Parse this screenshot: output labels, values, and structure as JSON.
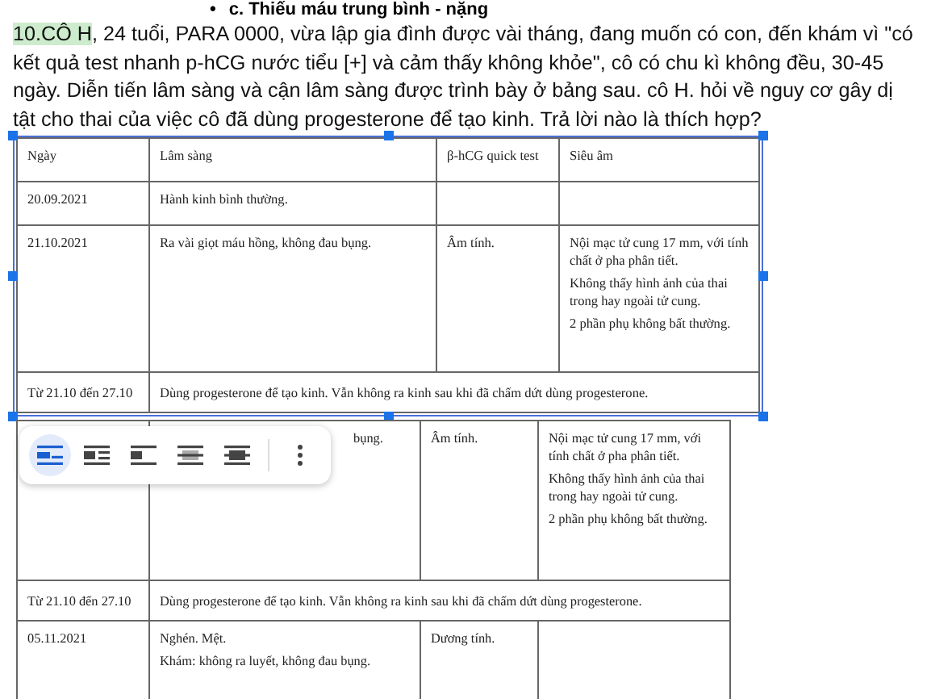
{
  "heading": {
    "bullet": "•",
    "text": "c. Thiếu máu trung bình - nặng"
  },
  "question": {
    "highlight": "10.CÔ H",
    "text": ", 24 tuổi, PARA 0000, vừa lập gia đình được vài tháng, đang muốn có con, đến khám vì \"có kết quả test nhanh p-hCG nước tiểu [+] và cảm thấy không khỏe\", cô có chu kì không đều, 30-45 ngày. Diễn tiến lâm sàng và cận lâm sàng được trình bày ở bảng sau. cô H. hỏi về nguy cơ gây dị tật cho thai của việc cô đã dùng progesterone để tạo kinh. Trả lời nào là thích hợp?"
  },
  "images": [
    {
      "selected": true,
      "rows": [
        {
          "kind": "header",
          "cells": [
            {
              "lines": [
                "Ngày"
              ]
            },
            {
              "lines": [
                "Lâm sàng"
              ]
            },
            {
              "lines": [
                "β-hCG quick test"
              ]
            },
            {
              "lines": [
                "Siêu âm"
              ]
            }
          ]
        },
        {
          "kind": "normal",
          "cells": [
            {
              "lines": [
                "20.09.2021"
              ]
            },
            {
              "lines": [
                "Hành kinh bình thường."
              ]
            },
            {},
            {}
          ]
        },
        {
          "kind": "normal",
          "cells": [
            {
              "lines": [
                "21.10.2021"
              ]
            },
            {
              "lines": [
                "Ra vài giọt máu hồng, không đau bụng."
              ]
            },
            {
              "lines": [
                "Âm tính."
              ]
            },
            {
              "lines": [
                "Nội mạc tử cung 17 mm, với tính chất ở pha phân tiết.",
                "Không thấy hình ảnh của thai trong hay ngoài tử cung.",
                "2 phần phụ không bất thường."
              ]
            }
          ]
        },
        {
          "kind": "span",
          "cells": [
            {
              "lines": [
                "Từ 21.10 đến 27.10"
              ]
            },
            {
              "lines": [
                "Dùng progesterone để tạo kinh. Vẫn không ra kinh sau khi đã chấm dứt dùng progesterone."
              ],
              "colspan": 3
            }
          ]
        }
      ]
    },
    {
      "selected": false,
      "rows": [
        {
          "kind": "normal",
          "cells": [
            {},
            {
              "lines": [
                "bụng."
              ],
              "covered": true
            },
            {
              "lines": [
                "Âm tính."
              ]
            },
            {
              "lines": [
                "Nội mạc tử cung 17 mm, với tính chất ở pha phân tiết.",
                "Không thấy hình ảnh của thai trong hay ngoài tử cung.",
                "2 phần phụ không bất thường."
              ]
            }
          ]
        },
        {
          "kind": "span",
          "cells": [
            {
              "lines": [
                "Từ 21.10 đến 27.10"
              ]
            },
            {
              "lines": [
                "Dùng progesterone để tạo kinh. Vẫn không ra kinh sau khi đã chấm dứt dùng progesterone."
              ],
              "colspan": 3
            }
          ]
        },
        {
          "kind": "normal",
          "cells": [
            {
              "lines": [
                "05.11.2021"
              ]
            },
            {
              "lines": [
                "Nghén. Mệt.",
                "Khám: không ra luyết, không đau bụng."
              ]
            },
            {
              "lines": [
                "Dương tính."
              ]
            },
            {}
          ]
        }
      ]
    }
  ],
  "toolbar": {
    "options": [
      {
        "kind": "inline",
        "selected": true
      },
      {
        "kind": "wrap",
        "selected": false
      },
      {
        "kind": "break",
        "selected": false
      },
      {
        "kind": "behind",
        "selected": false
      },
      {
        "kind": "front",
        "selected": false
      }
    ]
  }
}
